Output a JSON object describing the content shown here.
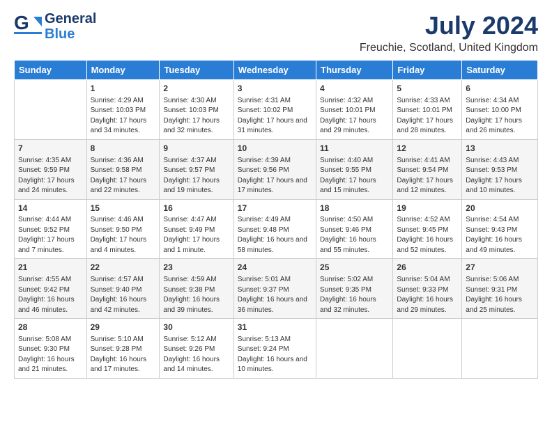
{
  "header": {
    "logo_general": "General",
    "logo_blue": "Blue",
    "month_title": "July 2024",
    "location": "Freuchie, Scotland, United Kingdom"
  },
  "days_of_week": [
    "Sunday",
    "Monday",
    "Tuesday",
    "Wednesday",
    "Thursday",
    "Friday",
    "Saturday"
  ],
  "weeks": [
    [
      {
        "day": "",
        "sunrise": "",
        "sunset": "",
        "daylight": ""
      },
      {
        "day": "1",
        "sunrise": "Sunrise: 4:29 AM",
        "sunset": "Sunset: 10:03 PM",
        "daylight": "Daylight: 17 hours and 34 minutes."
      },
      {
        "day": "2",
        "sunrise": "Sunrise: 4:30 AM",
        "sunset": "Sunset: 10:03 PM",
        "daylight": "Daylight: 17 hours and 32 minutes."
      },
      {
        "day": "3",
        "sunrise": "Sunrise: 4:31 AM",
        "sunset": "Sunset: 10:02 PM",
        "daylight": "Daylight: 17 hours and 31 minutes."
      },
      {
        "day": "4",
        "sunrise": "Sunrise: 4:32 AM",
        "sunset": "Sunset: 10:01 PM",
        "daylight": "Daylight: 17 hours and 29 minutes."
      },
      {
        "day": "5",
        "sunrise": "Sunrise: 4:33 AM",
        "sunset": "Sunset: 10:01 PM",
        "daylight": "Daylight: 17 hours and 28 minutes."
      },
      {
        "day": "6",
        "sunrise": "Sunrise: 4:34 AM",
        "sunset": "Sunset: 10:00 PM",
        "daylight": "Daylight: 17 hours and 26 minutes."
      }
    ],
    [
      {
        "day": "7",
        "sunrise": "Sunrise: 4:35 AM",
        "sunset": "Sunset: 9:59 PM",
        "daylight": "Daylight: 17 hours and 24 minutes."
      },
      {
        "day": "8",
        "sunrise": "Sunrise: 4:36 AM",
        "sunset": "Sunset: 9:58 PM",
        "daylight": "Daylight: 17 hours and 22 minutes."
      },
      {
        "day": "9",
        "sunrise": "Sunrise: 4:37 AM",
        "sunset": "Sunset: 9:57 PM",
        "daylight": "Daylight: 17 hours and 19 minutes."
      },
      {
        "day": "10",
        "sunrise": "Sunrise: 4:39 AM",
        "sunset": "Sunset: 9:56 PM",
        "daylight": "Daylight: 17 hours and 17 minutes."
      },
      {
        "day": "11",
        "sunrise": "Sunrise: 4:40 AM",
        "sunset": "Sunset: 9:55 PM",
        "daylight": "Daylight: 17 hours and 15 minutes."
      },
      {
        "day": "12",
        "sunrise": "Sunrise: 4:41 AM",
        "sunset": "Sunset: 9:54 PM",
        "daylight": "Daylight: 17 hours and 12 minutes."
      },
      {
        "day": "13",
        "sunrise": "Sunrise: 4:43 AM",
        "sunset": "Sunset: 9:53 PM",
        "daylight": "Daylight: 17 hours and 10 minutes."
      }
    ],
    [
      {
        "day": "14",
        "sunrise": "Sunrise: 4:44 AM",
        "sunset": "Sunset: 9:52 PM",
        "daylight": "Daylight: 17 hours and 7 minutes."
      },
      {
        "day": "15",
        "sunrise": "Sunrise: 4:46 AM",
        "sunset": "Sunset: 9:50 PM",
        "daylight": "Daylight: 17 hours and 4 minutes."
      },
      {
        "day": "16",
        "sunrise": "Sunrise: 4:47 AM",
        "sunset": "Sunset: 9:49 PM",
        "daylight": "Daylight: 17 hours and 1 minute."
      },
      {
        "day": "17",
        "sunrise": "Sunrise: 4:49 AM",
        "sunset": "Sunset: 9:48 PM",
        "daylight": "Daylight: 16 hours and 58 minutes."
      },
      {
        "day": "18",
        "sunrise": "Sunrise: 4:50 AM",
        "sunset": "Sunset: 9:46 PM",
        "daylight": "Daylight: 16 hours and 55 minutes."
      },
      {
        "day": "19",
        "sunrise": "Sunrise: 4:52 AM",
        "sunset": "Sunset: 9:45 PM",
        "daylight": "Daylight: 16 hours and 52 minutes."
      },
      {
        "day": "20",
        "sunrise": "Sunrise: 4:54 AM",
        "sunset": "Sunset: 9:43 PM",
        "daylight": "Daylight: 16 hours and 49 minutes."
      }
    ],
    [
      {
        "day": "21",
        "sunrise": "Sunrise: 4:55 AM",
        "sunset": "Sunset: 9:42 PM",
        "daylight": "Daylight: 16 hours and 46 minutes."
      },
      {
        "day": "22",
        "sunrise": "Sunrise: 4:57 AM",
        "sunset": "Sunset: 9:40 PM",
        "daylight": "Daylight: 16 hours and 42 minutes."
      },
      {
        "day": "23",
        "sunrise": "Sunrise: 4:59 AM",
        "sunset": "Sunset: 9:38 PM",
        "daylight": "Daylight: 16 hours and 39 minutes."
      },
      {
        "day": "24",
        "sunrise": "Sunrise: 5:01 AM",
        "sunset": "Sunset: 9:37 PM",
        "daylight": "Daylight: 16 hours and 36 minutes."
      },
      {
        "day": "25",
        "sunrise": "Sunrise: 5:02 AM",
        "sunset": "Sunset: 9:35 PM",
        "daylight": "Daylight: 16 hours and 32 minutes."
      },
      {
        "day": "26",
        "sunrise": "Sunrise: 5:04 AM",
        "sunset": "Sunset: 9:33 PM",
        "daylight": "Daylight: 16 hours and 29 minutes."
      },
      {
        "day": "27",
        "sunrise": "Sunrise: 5:06 AM",
        "sunset": "Sunset: 9:31 PM",
        "daylight": "Daylight: 16 hours and 25 minutes."
      }
    ],
    [
      {
        "day": "28",
        "sunrise": "Sunrise: 5:08 AM",
        "sunset": "Sunset: 9:30 PM",
        "daylight": "Daylight: 16 hours and 21 minutes."
      },
      {
        "day": "29",
        "sunrise": "Sunrise: 5:10 AM",
        "sunset": "Sunset: 9:28 PM",
        "daylight": "Daylight: 16 hours and 17 minutes."
      },
      {
        "day": "30",
        "sunrise": "Sunrise: 5:12 AM",
        "sunset": "Sunset: 9:26 PM",
        "daylight": "Daylight: 16 hours and 14 minutes."
      },
      {
        "day": "31",
        "sunrise": "Sunrise: 5:13 AM",
        "sunset": "Sunset: 9:24 PM",
        "daylight": "Daylight: 16 hours and 10 minutes."
      },
      {
        "day": "",
        "sunrise": "",
        "sunset": "",
        "daylight": ""
      },
      {
        "day": "",
        "sunrise": "",
        "sunset": "",
        "daylight": ""
      },
      {
        "day": "",
        "sunrise": "",
        "sunset": "",
        "daylight": ""
      }
    ]
  ]
}
